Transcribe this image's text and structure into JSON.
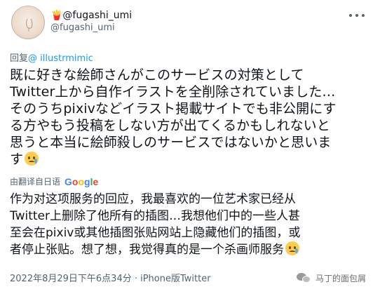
{
  "user": {
    "display_name": "🍟@fugashi_umi",
    "handle": "@fugashi_umi"
  },
  "reply": {
    "prefix": "回复",
    "mention": "@ illustrmimic"
  },
  "original_text": [
    "既に好きな絵師さんがこのサービスの対策として",
    "Twitter上から自作イラストを全削除されていました…",
    "そのうちpixivなどイラスト掲載サイトでも非公開にす",
    "る方やもう投稿をしない方が出てくるかもしれないと",
    "思うと本当に絵師殺しのサービスではないかと思いま",
    "す"
  ],
  "translate": {
    "label": "由翻译自日语",
    "provider": "Google"
  },
  "translated_text": [
    "作为对这项服务的回应，我最喜欢的一位艺术家已经从",
    "Twitter上删除了他所有的插图…我想他们中的一些人甚",
    "至会在pixiv或其他插图张贴网站上隐藏他们的插图，或",
    "者停止张贴。想了想，我觉得真的是一个杀画师服务"
  ],
  "meta": {
    "timestamp": "2022年8月29日下午6点34分 · iPhone版Twitter"
  },
  "watermark": {
    "text": "马丁的面包屑"
  },
  "colors": {
    "accent": "#1d9bf0",
    "secondary_text": "#536471",
    "primary_text": "#0f1419"
  }
}
